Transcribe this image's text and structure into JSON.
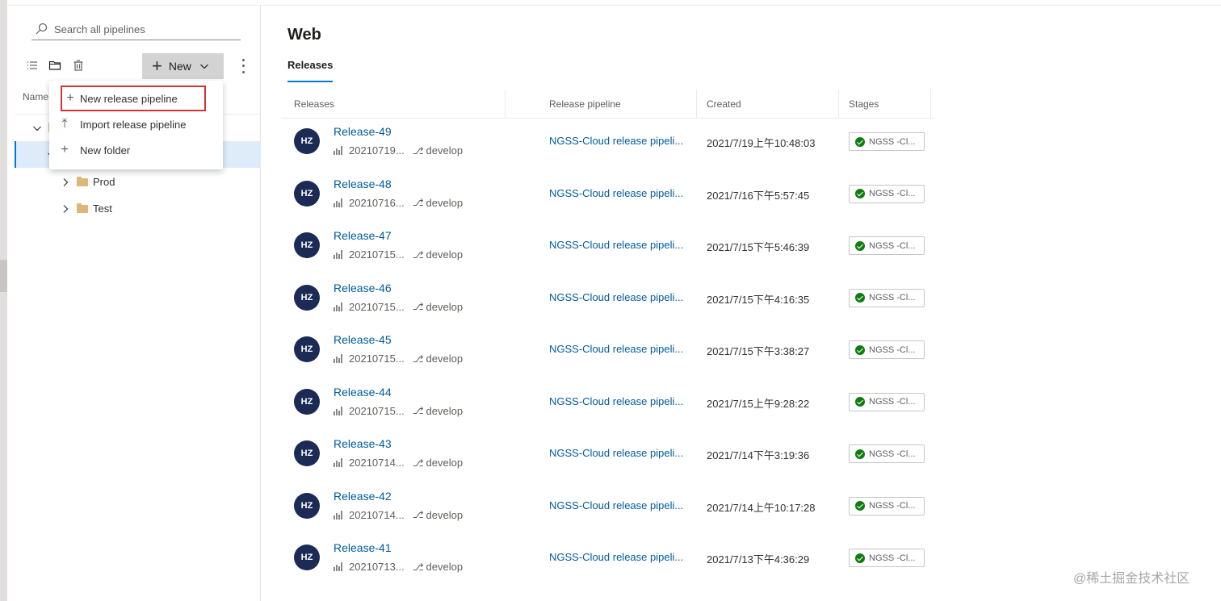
{
  "sidebar": {
    "search_placeholder": "Search all pipelines",
    "new_button_label": "New",
    "name_column": "Name",
    "tree": [
      {
        "label": "",
        "expanded": true
      },
      {
        "label": "",
        "expanded": true,
        "selected": true
      },
      {
        "label": "Prod",
        "expanded": false
      },
      {
        "label": "Test",
        "expanded": false
      }
    ]
  },
  "new_menu": {
    "items": [
      {
        "icon": "plus-icon",
        "label": "New release pipeline"
      },
      {
        "icon": "import-icon",
        "label": "Import release pipeline"
      },
      {
        "icon": "plus-icon",
        "label": "New folder"
      }
    ]
  },
  "main": {
    "title": "Web",
    "tab": "Releases",
    "columns": [
      "Releases",
      "Release pipeline",
      "Created",
      "Stages"
    ]
  },
  "releases": [
    {
      "avatar": "HZ",
      "name": "Release-49",
      "build": "20210719...",
      "branch": "develop",
      "pipeline": "NGSS-Cloud release pipeli...",
      "created": "2021/7/19上午10:48:03",
      "stage": "NGSS -Cl..."
    },
    {
      "avatar": "HZ",
      "name": "Release-48",
      "build": "20210716...",
      "branch": "develop",
      "pipeline": "NGSS-Cloud release pipeli...",
      "created": "2021/7/16下午5:57:45",
      "stage": "NGSS -Cl..."
    },
    {
      "avatar": "HZ",
      "name": "Release-47",
      "build": "20210715...",
      "branch": "develop",
      "pipeline": "NGSS-Cloud release pipeli...",
      "created": "2021/7/15下午5:46:39",
      "stage": "NGSS -Cl..."
    },
    {
      "avatar": "HZ",
      "name": "Release-46",
      "build": "20210715...",
      "branch": "develop",
      "pipeline": "NGSS-Cloud release pipeli...",
      "created": "2021/7/15下午4:16:35",
      "stage": "NGSS -Cl..."
    },
    {
      "avatar": "HZ",
      "name": "Release-45",
      "build": "20210715...",
      "branch": "develop",
      "pipeline": "NGSS-Cloud release pipeli...",
      "created": "2021/7/15下午3:38:27",
      "stage": "NGSS -Cl..."
    },
    {
      "avatar": "HZ",
      "name": "Release-44",
      "build": "20210715...",
      "branch": "develop",
      "pipeline": "NGSS-Cloud release pipeli...",
      "created": "2021/7/15上午9:28:22",
      "stage": "NGSS -Cl..."
    },
    {
      "avatar": "HZ",
      "name": "Release-43",
      "build": "20210714...",
      "branch": "develop",
      "pipeline": "NGSS-Cloud release pipeli...",
      "created": "2021/7/14下午3:19:36",
      "stage": "NGSS -Cl..."
    },
    {
      "avatar": "HZ",
      "name": "Release-42",
      "build": "20210714...",
      "branch": "develop",
      "pipeline": "NGSS-Cloud release pipeli...",
      "created": "2021/7/14上午10:17:28",
      "stage": "NGSS -Cl..."
    },
    {
      "avatar": "HZ",
      "name": "Release-41",
      "build": "20210713...",
      "branch": "develop",
      "pipeline": "NGSS-Cloud release pipeli...",
      "created": "2021/7/13下午4:36:29",
      "stage": "NGSS -Cl..."
    }
  ],
  "watermark": "@稀土掘金技术社区",
  "colors": {
    "accent": "#0078d4",
    "link": "#005a9e",
    "avatar": "#1b2b55",
    "success": "#107c10",
    "highlight_box": "#d13438"
  }
}
